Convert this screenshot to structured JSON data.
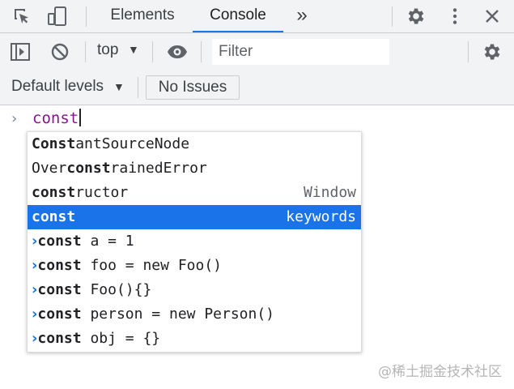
{
  "tabs": [
    {
      "label": "Elements",
      "active": false
    },
    {
      "label": "Console",
      "active": true
    }
  ],
  "more_tabs_glyph": "»",
  "toolbar": {
    "context": "top",
    "filter_placeholder": "Filter",
    "default_levels": "Default levels",
    "no_issues": "No Issues"
  },
  "console": {
    "prompt": "›",
    "input": "const"
  },
  "autocomplete": {
    "items": [
      {
        "pre": "",
        "match": "Const",
        "post": "antSourceNode",
        "subtitle": "",
        "selected": false,
        "history": false
      },
      {
        "pre": "Over",
        "match": "const",
        "post": "rainedError",
        "subtitle": "",
        "selected": false,
        "history": false
      },
      {
        "pre": "",
        "match": "const",
        "post": "ructor",
        "subtitle": "Window",
        "selected": false,
        "history": false
      },
      {
        "pre": "",
        "match": "const",
        "post": "",
        "subtitle": "keywords",
        "selected": true,
        "history": false
      },
      {
        "pre": "",
        "match": "const",
        "post": " a = 1",
        "subtitle": "",
        "selected": false,
        "history": true
      },
      {
        "pre": "",
        "match": "const",
        "post": " foo = new Foo()",
        "subtitle": "",
        "selected": false,
        "history": true
      },
      {
        "pre": "",
        "match": "const",
        "post": " Foo(){}",
        "subtitle": "",
        "selected": false,
        "history": true
      },
      {
        "pre": "",
        "match": "const",
        "post": " person = new Person()",
        "subtitle": "",
        "selected": false,
        "history": true
      },
      {
        "pre": "",
        "match": "const",
        "post": " obj = {}",
        "subtitle": "",
        "selected": false,
        "history": true
      }
    ],
    "history_glyph": "›"
  },
  "watermark": "@稀土掘金技术社区",
  "colors": {
    "accent": "#1a73e8",
    "toolbar_bg": "#f1f3f4",
    "keyword": "#881391"
  }
}
